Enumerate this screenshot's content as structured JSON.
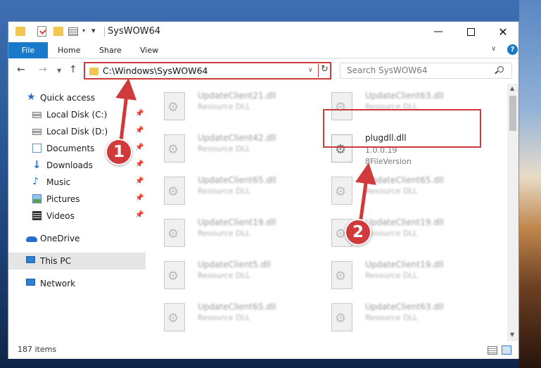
{
  "window": {
    "title": "SysWOW64",
    "min_glyph": "—",
    "close_glyph": "✕"
  },
  "ribbon": {
    "tabs": [
      "File",
      "Home",
      "Share",
      "View"
    ],
    "help": "?"
  },
  "nav": {
    "back": "←",
    "forward": "→",
    "recent": "▼",
    "up": "↑",
    "address": "C:\\Windows\\SysWOW64",
    "search_placeholder": "Search SysWOW64"
  },
  "sidebar": {
    "items": [
      {
        "label": "Quick access",
        "icon": "star-icon"
      },
      {
        "label": "Local Disk (C:)",
        "icon": "disk-icon",
        "pinned": true
      },
      {
        "label": "Local Disk (D:)",
        "icon": "disk-icon",
        "pinned": true
      },
      {
        "label": "Documents",
        "icon": "documents-icon",
        "pinned": true
      },
      {
        "label": "Downloads",
        "icon": "downloads-icon",
        "pinned": true
      },
      {
        "label": "Music",
        "icon": "music-icon",
        "pinned": true
      },
      {
        "label": "Pictures",
        "icon": "pictures-icon",
        "pinned": true
      },
      {
        "label": "Videos",
        "icon": "videos-icon",
        "pinned": true
      },
      {
        "label": "OneDrive",
        "icon": "onedrive-icon"
      },
      {
        "label": "This PC",
        "icon": "computer-icon",
        "selected": true
      },
      {
        "label": "Network",
        "icon": "network-icon"
      }
    ]
  },
  "files": {
    "left": [
      {
        "name": "UpdateClient21.dll",
        "desc": "Resource DLL"
      },
      {
        "name": "UpdateClient42.dll",
        "desc": "Resource DLL"
      },
      {
        "name": "UpdateClient65.dll",
        "desc": "Resource DLL"
      },
      {
        "name": "UpdateClient19.dll",
        "desc": "Resource DLL"
      },
      {
        "name": "UpdateClient5.dll",
        "desc": "Resource DLL"
      },
      {
        "name": "UpdateClient65.dll",
        "desc": "Resource DLL"
      }
    ],
    "right": [
      {
        "name": "UpdateClient63.dll",
        "desc": "Resource DLL"
      },
      {
        "name": "plugdll.dll",
        "version": "1.0.0.19",
        "desc": "8FileVersion",
        "highlighted": true
      },
      {
        "name": "UpdateClient65.dll",
        "desc": "Resource DLL"
      },
      {
        "name": "UpdateClient19.dll",
        "desc": "Resource DLL"
      },
      {
        "name": "UpdateClient19.dll",
        "desc": "Resource DLL"
      },
      {
        "name": "UpdateClient63.dll",
        "desc": "Resource DLL"
      }
    ]
  },
  "status": {
    "item_count": "187 items"
  },
  "annotations": {
    "step1": "1",
    "step2": "2",
    "color": "#d13a3a"
  }
}
